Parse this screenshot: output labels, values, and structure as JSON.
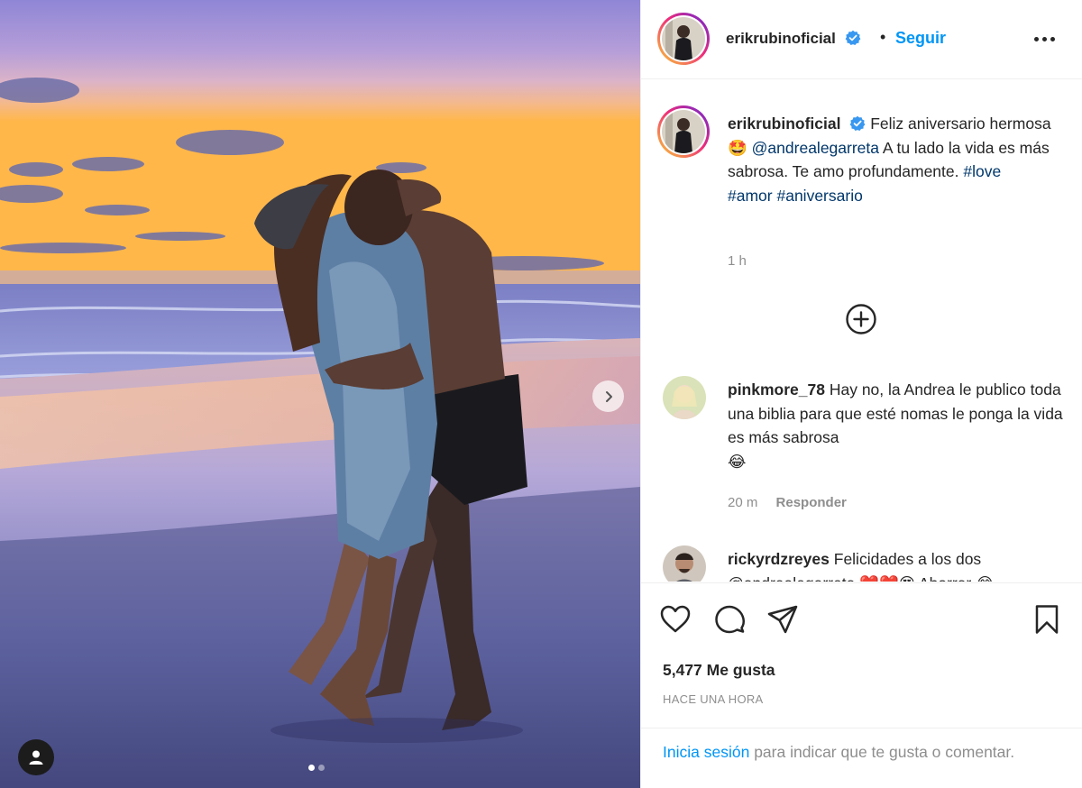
{
  "post": {
    "username": "erikrubinoficial",
    "separator": "•",
    "follow_label": "Seguir",
    "more_label": "•••"
  },
  "media": {
    "slide_count": 2,
    "active_slide": 1
  },
  "caption": {
    "username": "erikrubinoficial",
    "text_1": "Feliz aniversario hermosa",
    "emoji_1": "🤩",
    "mention": "@andrealegarreta",
    "text_2": "A tu lado la vida es más sabrosa. Te amo profundamente.",
    "hashtag_1": "#love",
    "hashtag_2": "#amor",
    "hashtag_3": "#aniversario",
    "time": "1 h"
  },
  "comments": [
    {
      "username": "pinkmore_78",
      "text": "Hay no, la Andrea le publico toda una biblia para que esté nomas le ponga la vida es más sabrosa",
      "emoji": "😂",
      "time": "20 m",
      "reply_label": "Responder"
    },
    {
      "username": "rickyrdzreyes",
      "text": "Felicidades a los dos",
      "text_cut": "@andrealegarreta ❤️❤️😍 Ahorrar 😂"
    }
  ],
  "footer": {
    "likes": "5,477 Me gusta",
    "timestamp": "HACE UNA HORA",
    "login_link": "Inicia sesión",
    "login_text": "para indicar que te gusta o comentar."
  }
}
